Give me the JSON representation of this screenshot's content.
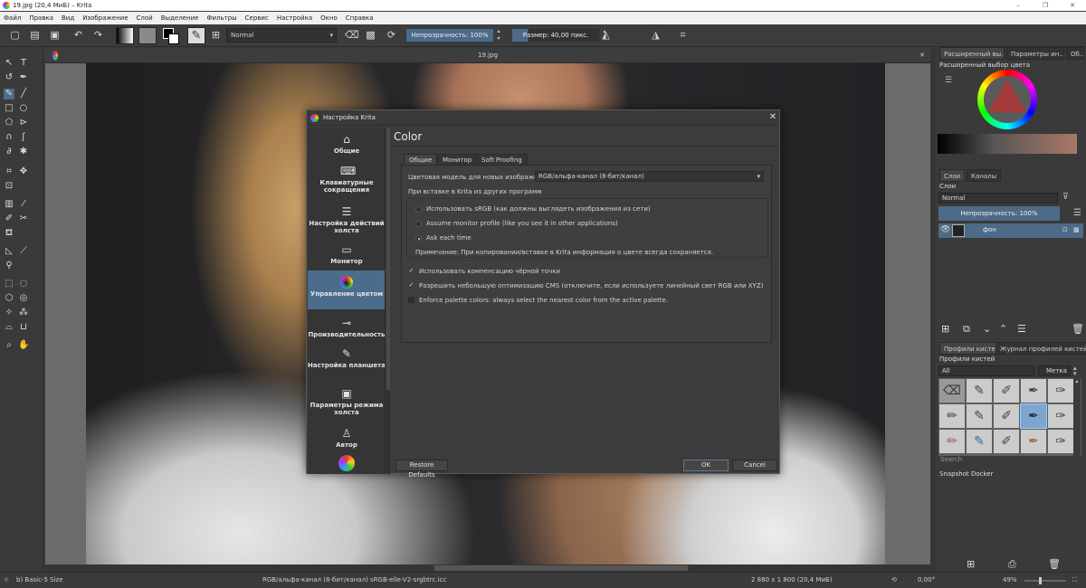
{
  "window": {
    "title": "19.jpg (20,4 МиБ)  – Krita",
    "min": "–",
    "max": "❐",
    "close": "✕"
  },
  "menu": [
    "Файл",
    "Правка",
    "Вид",
    "Изображение",
    "Слой",
    "Выделение",
    "Фильтры",
    "Сервис",
    "Настройка",
    "Окно",
    "Справка"
  ],
  "toolbar": {
    "blend_mode": "Normal",
    "opacity": "Непрозрачность: 100%",
    "size": "Размер: 40,00 пикс."
  },
  "document": {
    "tab_title": "19.jpg"
  },
  "dock": {
    "tabs": [
      "Расширенный вы...",
      "Параметры ин...",
      "Об..."
    ],
    "color_selector_title": "Расширенный выбор цвета",
    "layers_tabs": [
      "Слои",
      "Каналы"
    ],
    "layers_title": "Слои",
    "layers_blend": "Normal",
    "layers_opacity": "Непрозрачность: 100%",
    "layer_name": "фон",
    "brush_tabs": [
      "Профили кистей",
      "Журнал профилей кистей"
    ],
    "brush_title": "Профили кистей",
    "brush_filter": "All",
    "brush_tag": "Метка",
    "search_placeholder": "Search",
    "snapshot": "Snapshot Docker"
  },
  "status": {
    "brush": "b) Basic-5 Size",
    "color_model": "RGB/альфа-канал (8-бит/канал)  sRGB-elle-V2-srgbtrc.icc",
    "image_size": "2 880 x 1 800 (20,4 МиБ)",
    "rotation": "0,00°",
    "zoom": "49%"
  },
  "dialog": {
    "title": "Настройка Krita",
    "close": "✕",
    "sidebar": [
      {
        "label": "Общие",
        "icon": "⌂"
      },
      {
        "label": "Клавиатурные сокращения",
        "icon": "⌨"
      },
      {
        "label": "Настройка действий холста",
        "icon": "☰"
      },
      {
        "label": "Монитор",
        "icon": "▭"
      },
      {
        "label": "Управление цветом",
        "icon": "◉"
      },
      {
        "label": "Производительность",
        "icon": "⊸"
      },
      {
        "label": "Настройка планшета",
        "icon": "✎"
      },
      {
        "label": "Параметры режима холста",
        "icon": "▣"
      },
      {
        "label": "Автор",
        "icon": "♙"
      }
    ],
    "page_title": "Color",
    "tabs": [
      "Общие",
      "Монитор",
      "Soft Proofing"
    ],
    "color_model_label": "Цветовая модель для новых изображений:",
    "color_model_value": "RGB/альфа-канал (8-бит/канал)",
    "paste_group_label": "При вставке в Krita из других программ",
    "radio_srgb": "Использовать sRGB (как должны выглядеть изображения из сети)",
    "radio_monitor": "Assume monitor profile (like you see it in other applications)",
    "radio_ask": "Ask each time",
    "note": "Примечание: При копировании/вставке в Krita информация о цвете всегда сохраняется.",
    "chk_blackpoint": "Использовать компенсацию чёрной точки",
    "chk_cms": "Разрешить небольшую оптимизацию CMS (отключите, если используете линейный свет RGB или XYZ)",
    "chk_palette": "Enforce palette colors: always select the nearest color from the active palette.",
    "restore_defaults": "Restore Defaults",
    "ok": "OK",
    "cancel": "Cancel"
  }
}
